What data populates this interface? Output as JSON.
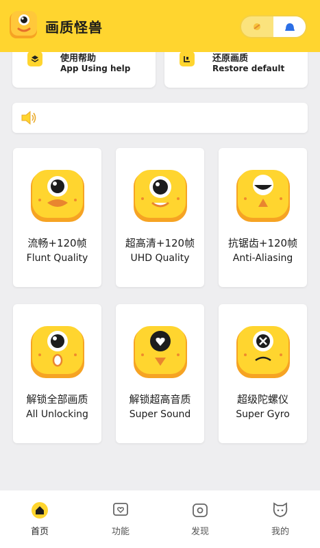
{
  "header": {
    "title": "画质怪兽",
    "bg_color": "#ffd52f"
  },
  "top_cards": [
    {
      "cn": "使用帮助",
      "en": "App Using help",
      "icon": "layers-icon"
    },
    {
      "cn": "还原画质",
      "en": "Restore default",
      "icon": "restore-icon"
    }
  ],
  "notice": {
    "icon": "speaker-icon",
    "text": ""
  },
  "features": [
    {
      "cn": "流畅+120帧",
      "en": "Flunt Quality"
    },
    {
      "cn": "超高清+120帧",
      "en": "UHD Quality"
    },
    {
      "cn": "抗锯齿+120帧",
      "en": "Anti-Aliasing"
    },
    {
      "cn": "解锁全部画质",
      "en": "All Unlocking"
    },
    {
      "cn": "解锁超高音质",
      "en": "Super Sound"
    },
    {
      "cn": "超级陀螺仪",
      "en": "Super Gyro"
    }
  ],
  "nav": [
    {
      "label": "首页",
      "icon": "home-icon",
      "active": true
    },
    {
      "label": "功能",
      "icon": "heart-chat-icon",
      "active": false
    },
    {
      "label": "发现",
      "icon": "discover-icon",
      "active": false
    },
    {
      "label": "我的",
      "icon": "profile-cat-icon",
      "active": false
    }
  ]
}
